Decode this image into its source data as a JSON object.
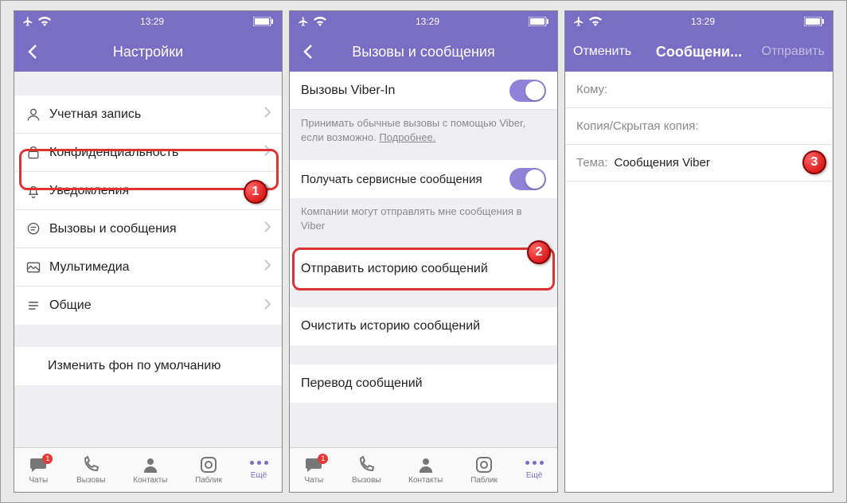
{
  "time": "13:29",
  "screen1": {
    "title": "Настройки",
    "rows": {
      "account": "Учетная запись",
      "privacy": "Конфиденциальность",
      "notifications": "Уведомления",
      "calls_msgs": "Вызовы и сообщения",
      "media": "Мультимедиа",
      "general": "Общие",
      "wallpaper": "Изменить фон по умолчанию"
    }
  },
  "screen2": {
    "title": "Вызовы и сообщения",
    "viber_in": "Вызовы Viber-In",
    "viber_in_hint_a": "Принимать обычные вызовы с помощью Viber, если возможно. ",
    "viber_in_hint_link": "Подробнее.",
    "service_msgs": "Получать сервисные сообщения",
    "service_hint": "Компании могут отправлять мне сообщения в Viber",
    "send_history": "Отправить историю сообщений",
    "clear_history": "Очистить историю сообщений",
    "translate": "Перевод сообщений"
  },
  "screen3": {
    "cancel": "Отменить",
    "title": "Сообщени...",
    "send": "Отправить",
    "to": "Кому:",
    "cc": "Копия/Скрытая копия:",
    "subject_label": "Тема:",
    "subject_value": "Сообщения Viber"
  },
  "tabs": {
    "chats": "Чаты",
    "calls": "Вызовы",
    "contacts": "Контакты",
    "public": "Паблик",
    "more": "Ещё",
    "badge": "1"
  },
  "steps": {
    "1": "1",
    "2": "2",
    "3": "3"
  }
}
